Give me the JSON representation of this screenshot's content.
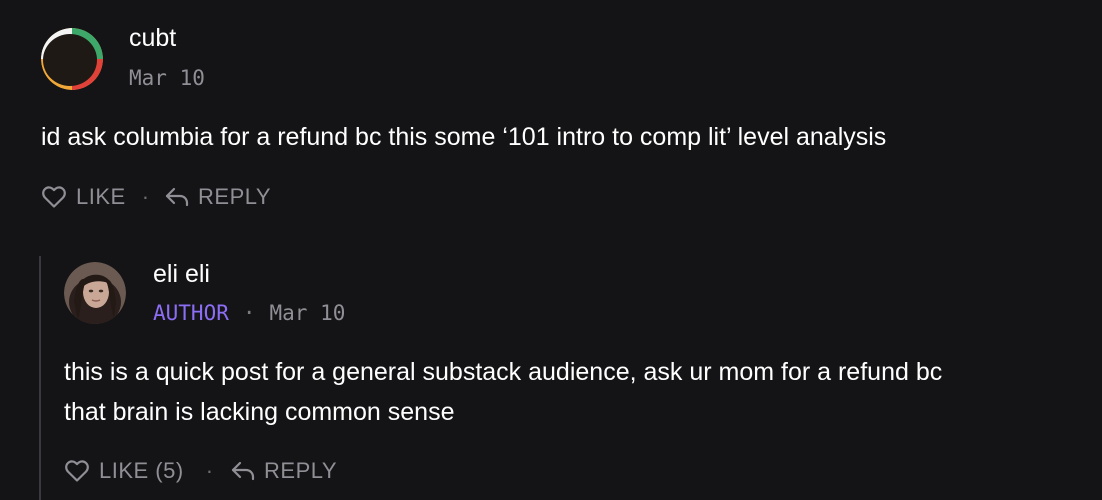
{
  "comments": {
    "top": {
      "author": "cubt",
      "date": "Mar 10",
      "text": "id ask columbia for a refund bc this some ‘101 intro to comp lit’ level analysis",
      "like_label": "LIKE",
      "reply_label": "REPLY"
    },
    "reply": {
      "author": "eli eli",
      "author_tag": "AUTHOR",
      "date": "Mar 10",
      "text_line1": "this is a quick post for a general substack audience, ask ur mom for a refund bc",
      "text_line2": "that brain is lacking common sense",
      "like_label": "LIKE (5)",
      "reply_label": "REPLY"
    }
  },
  "colors": {
    "background": "#141416",
    "text": "#ffffff",
    "muted": "#8f8f95",
    "author_tag": "#8c6ef5"
  },
  "icons": {
    "like": "heart-outline-icon",
    "reply": "reply-arrow-icon"
  }
}
